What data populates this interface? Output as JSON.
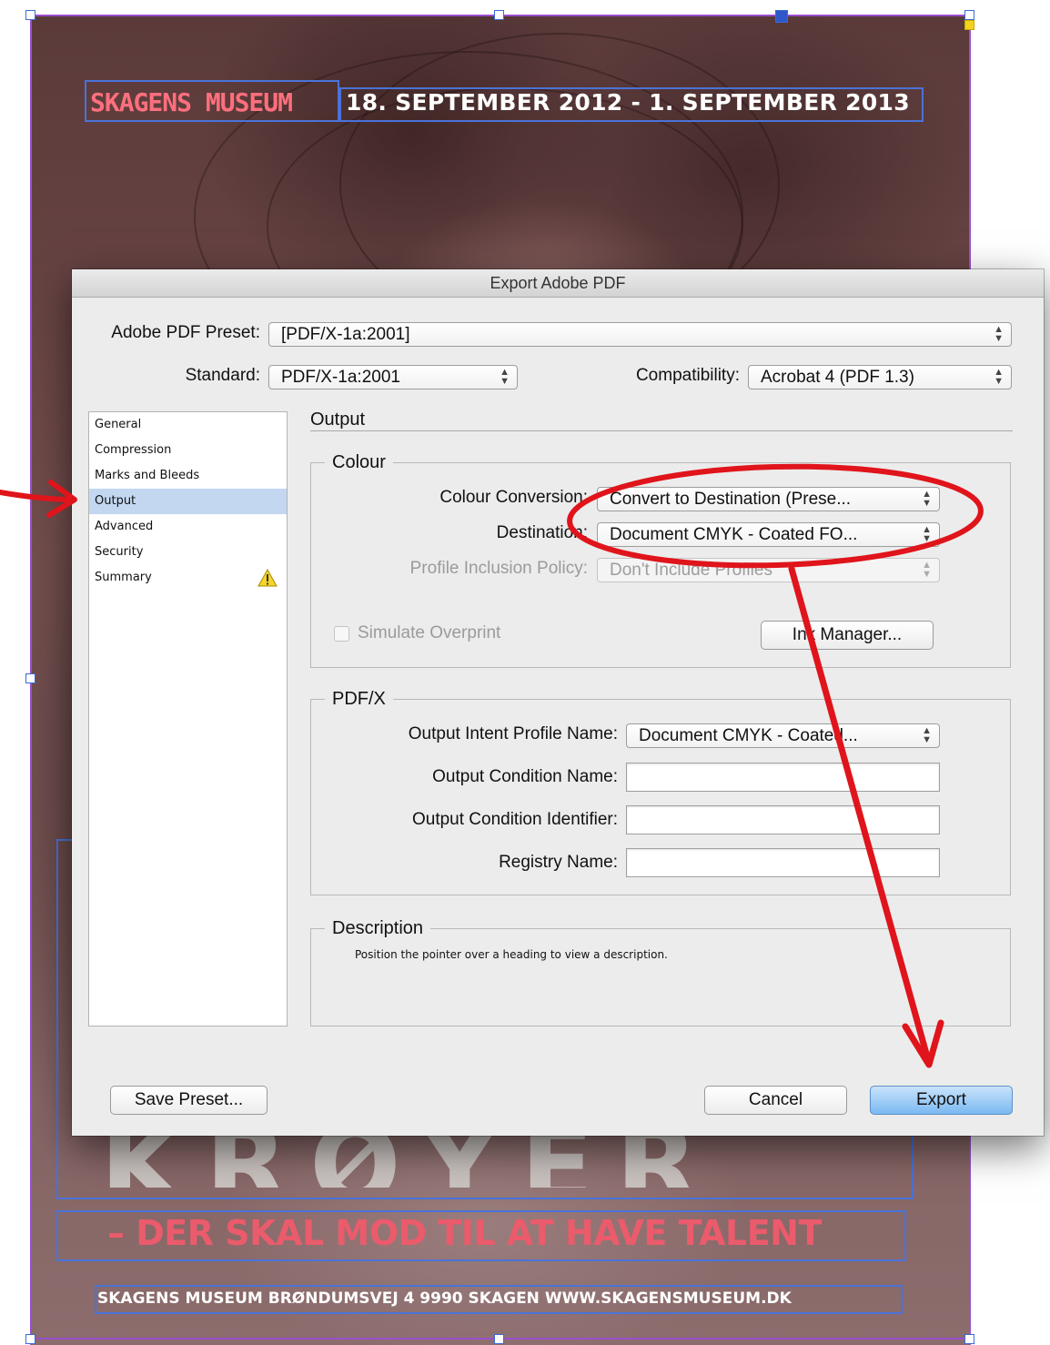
{
  "poster": {
    "logo": "SKAGENS MUSEUM",
    "date_range": "18. SEPTEMBER 2012 - 1. SEPTEMBER 2013",
    "big_name": "KRØYER",
    "tagline": "– DER SKAL MOD TIL AT HAVE TALENT",
    "address": "SKAGENS MUSEUM  BRØNDUMSVEJ 4  9990 SKAGEN  WWW.SKAGENSMUSEUM.DK"
  },
  "dialog": {
    "title": "Export Adobe PDF",
    "preset": {
      "label": "Adobe PDF Preset:",
      "value": "[PDF/X-1a:2001]"
    },
    "standard": {
      "label": "Standard:",
      "value": "PDF/X-1a:2001"
    },
    "compatibility": {
      "label": "Compatibility:",
      "value": "Acrobat 4 (PDF 1.3)"
    },
    "sidebar": {
      "items": [
        {
          "label": "General"
        },
        {
          "label": "Compression"
        },
        {
          "label": "Marks and Bleeds"
        },
        {
          "label": "Output"
        },
        {
          "label": "Advanced"
        },
        {
          "label": "Security"
        },
        {
          "label": "Summary"
        }
      ]
    },
    "section_title": "Output",
    "colour": {
      "title": "Colour",
      "conversion": {
        "label": "Colour Conversion:",
        "value": "Convert to Destination (Prese..."
      },
      "destination": {
        "label": "Destination:",
        "value": "Document CMYK - Coated FO..."
      },
      "profile_policy": {
        "label": "Profile Inclusion Policy:",
        "value": "Don't Include Profiles"
      },
      "simulate_overprint": {
        "label": "Simulate Overprint",
        "checked": false
      },
      "ink_manager": "Ink Manager..."
    },
    "pdfx": {
      "title": "PDF/X",
      "intent_profile": {
        "label": "Output Intent Profile Name:",
        "value": "Document CMYK - Coated..."
      },
      "condition_name": {
        "label": "Output Condition Name:",
        "value": ""
      },
      "condition_identifier": {
        "label": "Output Condition Identifier:",
        "value": ""
      },
      "registry_name": {
        "label": "Registry Name:",
        "value": ""
      }
    },
    "description": {
      "title": "Description",
      "text": "Position the pointer over a heading to view a description."
    },
    "buttons": {
      "save_preset": "Save Preset...",
      "cancel": "Cancel",
      "export": "Export"
    }
  },
  "colors": {
    "annotation_red": "#e0141b",
    "selection_blue": "#c3d7f1",
    "frame_purple": "#9a4fd0"
  }
}
